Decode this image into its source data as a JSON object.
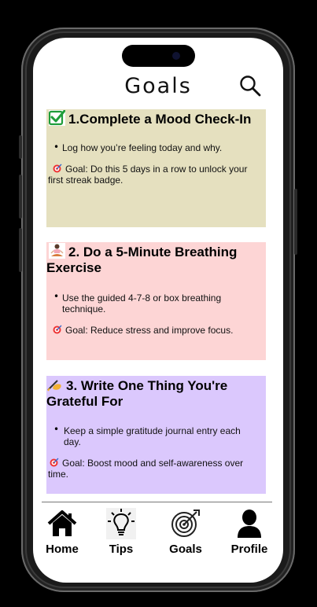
{
  "page": {
    "title": "Goals"
  },
  "cards": [
    {
      "heading": "1.Complete a Mood Check-In",
      "icon": "check-mark-icon",
      "bullet": "Log how you’re feeling today and why.",
      "goal": "Goal: Do this 5 days in a row to unlock your first streak badge.",
      "color": "#e5e0bf"
    },
    {
      "heading": "2. Do a 5-Minute Breathing Exercise",
      "icon": "meditation-icon",
      "bullet": "Use the guided 4-7-8 or box breathing technique.",
      "goal": "Goal: Reduce stress and improve focus.",
      "color": "#fdd5d5"
    },
    {
      "heading": "3. Write One Thing You're Grateful For",
      "icon": "writing-hand-icon",
      "bullet": "Keep a simple gratitude journal entry each day.",
      "goal": "Goal: Boost mood and self-awareness over time.",
      "color": "#dbc8fd"
    }
  ],
  "nav": {
    "home": "Home",
    "tips": "Tips",
    "goals": "Goals",
    "profile": "Profile"
  }
}
